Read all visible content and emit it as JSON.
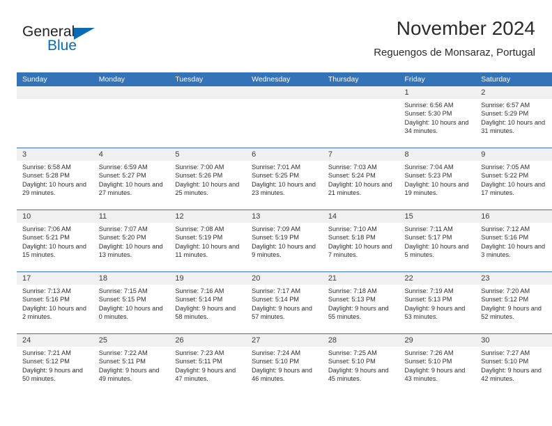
{
  "branding": {
    "logo_text_primary": "General",
    "logo_text_secondary": "Blue",
    "brand_color": "#0a6ab4"
  },
  "header": {
    "title": "November 2024",
    "subtitle": "Reguengos de Monsaraz, Portugal"
  },
  "theme": {
    "header_row_bg": "#3573b9",
    "day_band_bg": "#f0f0f0",
    "row_separator": "#3573b9"
  },
  "calendar": {
    "weekday_headers": [
      "Sunday",
      "Monday",
      "Tuesday",
      "Wednesday",
      "Thursday",
      "Friday",
      "Saturday"
    ],
    "weeks": [
      [
        {
          "day": "",
          "empty": true
        },
        {
          "day": "",
          "empty": true
        },
        {
          "day": "",
          "empty": true
        },
        {
          "day": "",
          "empty": true
        },
        {
          "day": "",
          "empty": true
        },
        {
          "day": "1",
          "sunrise": "Sunrise: 6:56 AM",
          "sunset": "Sunset: 5:30 PM",
          "daylight": "Daylight: 10 hours and 34 minutes."
        },
        {
          "day": "2",
          "sunrise": "Sunrise: 6:57 AM",
          "sunset": "Sunset: 5:29 PM",
          "daylight": "Daylight: 10 hours and 31 minutes."
        }
      ],
      [
        {
          "day": "3",
          "sunrise": "Sunrise: 6:58 AM",
          "sunset": "Sunset: 5:28 PM",
          "daylight": "Daylight: 10 hours and 29 minutes."
        },
        {
          "day": "4",
          "sunrise": "Sunrise: 6:59 AM",
          "sunset": "Sunset: 5:27 PM",
          "daylight": "Daylight: 10 hours and 27 minutes."
        },
        {
          "day": "5",
          "sunrise": "Sunrise: 7:00 AM",
          "sunset": "Sunset: 5:26 PM",
          "daylight": "Daylight: 10 hours and 25 minutes."
        },
        {
          "day": "6",
          "sunrise": "Sunrise: 7:01 AM",
          "sunset": "Sunset: 5:25 PM",
          "daylight": "Daylight: 10 hours and 23 minutes."
        },
        {
          "day": "7",
          "sunrise": "Sunrise: 7:03 AM",
          "sunset": "Sunset: 5:24 PM",
          "daylight": "Daylight: 10 hours and 21 minutes."
        },
        {
          "day": "8",
          "sunrise": "Sunrise: 7:04 AM",
          "sunset": "Sunset: 5:23 PM",
          "daylight": "Daylight: 10 hours and 19 minutes."
        },
        {
          "day": "9",
          "sunrise": "Sunrise: 7:05 AM",
          "sunset": "Sunset: 5:22 PM",
          "daylight": "Daylight: 10 hours and 17 minutes."
        }
      ],
      [
        {
          "day": "10",
          "sunrise": "Sunrise: 7:06 AM",
          "sunset": "Sunset: 5:21 PM",
          "daylight": "Daylight: 10 hours and 15 minutes."
        },
        {
          "day": "11",
          "sunrise": "Sunrise: 7:07 AM",
          "sunset": "Sunset: 5:20 PM",
          "daylight": "Daylight: 10 hours and 13 minutes."
        },
        {
          "day": "12",
          "sunrise": "Sunrise: 7:08 AM",
          "sunset": "Sunset: 5:19 PM",
          "daylight": "Daylight: 10 hours and 11 minutes."
        },
        {
          "day": "13",
          "sunrise": "Sunrise: 7:09 AM",
          "sunset": "Sunset: 5:19 PM",
          "daylight": "Daylight: 10 hours and 9 minutes."
        },
        {
          "day": "14",
          "sunrise": "Sunrise: 7:10 AM",
          "sunset": "Sunset: 5:18 PM",
          "daylight": "Daylight: 10 hours and 7 minutes."
        },
        {
          "day": "15",
          "sunrise": "Sunrise: 7:11 AM",
          "sunset": "Sunset: 5:17 PM",
          "daylight": "Daylight: 10 hours and 5 minutes."
        },
        {
          "day": "16",
          "sunrise": "Sunrise: 7:12 AM",
          "sunset": "Sunset: 5:16 PM",
          "daylight": "Daylight: 10 hours and 3 minutes."
        }
      ],
      [
        {
          "day": "17",
          "sunrise": "Sunrise: 7:13 AM",
          "sunset": "Sunset: 5:16 PM",
          "daylight": "Daylight: 10 hours and 2 minutes."
        },
        {
          "day": "18",
          "sunrise": "Sunrise: 7:15 AM",
          "sunset": "Sunset: 5:15 PM",
          "daylight": "Daylight: 10 hours and 0 minutes."
        },
        {
          "day": "19",
          "sunrise": "Sunrise: 7:16 AM",
          "sunset": "Sunset: 5:14 PM",
          "daylight": "Daylight: 9 hours and 58 minutes."
        },
        {
          "day": "20",
          "sunrise": "Sunrise: 7:17 AM",
          "sunset": "Sunset: 5:14 PM",
          "daylight": "Daylight: 9 hours and 57 minutes."
        },
        {
          "day": "21",
          "sunrise": "Sunrise: 7:18 AM",
          "sunset": "Sunset: 5:13 PM",
          "daylight": "Daylight: 9 hours and 55 minutes."
        },
        {
          "day": "22",
          "sunrise": "Sunrise: 7:19 AM",
          "sunset": "Sunset: 5:13 PM",
          "daylight": "Daylight: 9 hours and 53 minutes."
        },
        {
          "day": "23",
          "sunrise": "Sunrise: 7:20 AM",
          "sunset": "Sunset: 5:12 PM",
          "daylight": "Daylight: 9 hours and 52 minutes."
        }
      ],
      [
        {
          "day": "24",
          "sunrise": "Sunrise: 7:21 AM",
          "sunset": "Sunset: 5:12 PM",
          "daylight": "Daylight: 9 hours and 50 minutes."
        },
        {
          "day": "25",
          "sunrise": "Sunrise: 7:22 AM",
          "sunset": "Sunset: 5:11 PM",
          "daylight": "Daylight: 9 hours and 49 minutes."
        },
        {
          "day": "26",
          "sunrise": "Sunrise: 7:23 AM",
          "sunset": "Sunset: 5:11 PM",
          "daylight": "Daylight: 9 hours and 47 minutes."
        },
        {
          "day": "27",
          "sunrise": "Sunrise: 7:24 AM",
          "sunset": "Sunset: 5:10 PM",
          "daylight": "Daylight: 9 hours and 46 minutes."
        },
        {
          "day": "28",
          "sunrise": "Sunrise: 7:25 AM",
          "sunset": "Sunset: 5:10 PM",
          "daylight": "Daylight: 9 hours and 45 minutes."
        },
        {
          "day": "29",
          "sunrise": "Sunrise: 7:26 AM",
          "sunset": "Sunset: 5:10 PM",
          "daylight": "Daylight: 9 hours and 43 minutes."
        },
        {
          "day": "30",
          "sunrise": "Sunrise: 7:27 AM",
          "sunset": "Sunset: 5:10 PM",
          "daylight": "Daylight: 9 hours and 42 minutes."
        }
      ]
    ]
  }
}
